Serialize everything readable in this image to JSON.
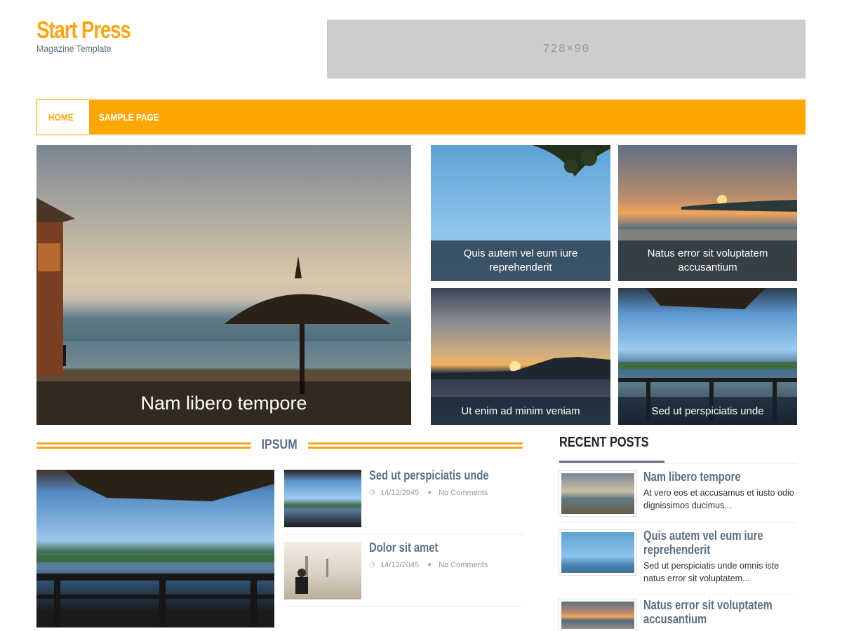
{
  "header": {
    "site_title": "Start Press",
    "tagline": "Magazine Template",
    "ad_text": "728×90"
  },
  "nav": {
    "items": [
      {
        "label": "HOME",
        "active": true
      },
      {
        "label": "SAMPLE PAGE",
        "active": false
      }
    ]
  },
  "featured": {
    "main": {
      "title": "Nam libero tempore"
    },
    "tiles": [
      {
        "title": "Quis autem vel eum iure reprehenderit"
      },
      {
        "title": "Natus error sit voluptatem accusantium"
      },
      {
        "title": "Ut enim ad minim veniam"
      },
      {
        "title": "Sed ut perspiciatis unde"
      }
    ]
  },
  "ipsum": {
    "section_title": "IPSUM",
    "posts": [
      {
        "title": "Sed ut perspiciatis unde",
        "date": "14/12/2045",
        "comments": "No Comments"
      },
      {
        "title": "Dolor sit amet",
        "date": "14/12/2045",
        "comments": "No Comments"
      }
    ]
  },
  "sidebar": {
    "title": "RECENT POSTS",
    "posts": [
      {
        "title": "Nam libero tempore",
        "excerpt": "At vero eos et accusamus et iusto odio dignissimos ducimus..."
      },
      {
        "title": "Quis autem vel eum iure reprehenderit",
        "excerpt": "Sed ut perspiciatis unde omnis iste natus error sit voluptatem..."
      },
      {
        "title": "Natus error sit voluptatem accusantium",
        "excerpt": ""
      }
    ]
  },
  "colors": {
    "accent": "#ffa600",
    "title_orange": "#f9a51a",
    "heading_slate": "#5d6f83",
    "ad_gray": "#cdcdcd"
  }
}
